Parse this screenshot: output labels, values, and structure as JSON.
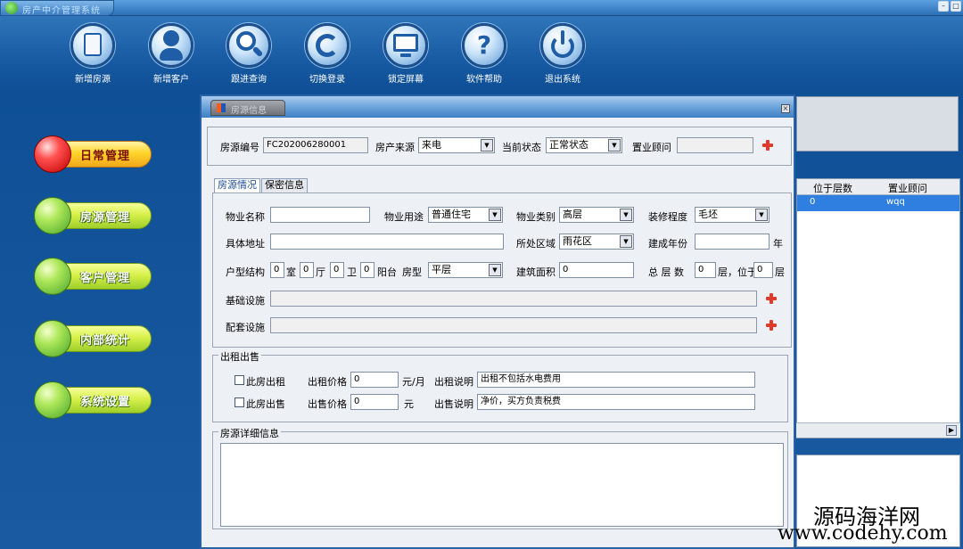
{
  "app": {
    "title": "房产中介管理系统"
  },
  "toolbar": {
    "items": [
      {
        "label": "新增房源",
        "icon": "document-icon"
      },
      {
        "label": "新增客户",
        "icon": "user-icon"
      },
      {
        "label": "跟进查询",
        "icon": "search-icon"
      },
      {
        "label": "切换登录",
        "icon": "refresh-icon"
      },
      {
        "label": "锁定屏幕",
        "icon": "monitor-lock-icon"
      },
      {
        "label": "软件帮助",
        "icon": "help-icon"
      },
      {
        "label": "退出系统",
        "icon": "power-icon"
      }
    ]
  },
  "nav": {
    "items": [
      {
        "label": "日常管理",
        "active": true
      },
      {
        "label": "房源管理",
        "active": false
      },
      {
        "label": "客户管理",
        "active": false
      },
      {
        "label": "内部统计",
        "active": false
      },
      {
        "label": "系统设置",
        "active": false
      }
    ]
  },
  "background_grid": {
    "columns": [
      "位于层数",
      "置业顾问"
    ],
    "rows": [
      {
        "floor": "0",
        "agent": "wqq"
      }
    ]
  },
  "dialog": {
    "title": "房源信息",
    "header": {
      "code_label": "房源编号",
      "code_value": "FC202006280001",
      "source_label": "房产来源",
      "source_value": "来电",
      "status_label": "当前状态",
      "status_value": "正常状态",
      "agent_label": "置业顾问",
      "agent_value": ""
    },
    "tabs": [
      "房源情况",
      "保密信息"
    ],
    "info": {
      "property_name_label": "物业名称",
      "property_name_value": "",
      "usage_label": "物业用途",
      "usage_value": "普通住宅",
      "category_label": "物业类别",
      "category_value": "高层",
      "decoration_label": "装修程度",
      "decoration_value": "毛坯",
      "address_label": "具体地址",
      "address_value": "",
      "district_label": "所处区域",
      "district_value": "雨花区",
      "year_label": "建成年份",
      "year_value": "",
      "year_unit": "年",
      "layout_label": "户型结构",
      "room_value": "0",
      "room_unit": "室",
      "hall_value": "0",
      "hall_unit": "厅",
      "bath_value": "0",
      "bath_unit": "卫",
      "balcony_value": "0",
      "balcony_unit": "阳台",
      "type_label": "房型",
      "type_value": "平层",
      "area_label": "建筑面积",
      "area_value": "0",
      "floors_label": "总 层 数",
      "floors_value": "0",
      "floors_unit": "层，位于",
      "floor_at_value": "0",
      "floor_at_unit": "层",
      "facility_label": "基础设施",
      "facility_value": "",
      "equipment_label": "配套设施",
      "equipment_value": ""
    },
    "rent_sale": {
      "legend": "出租出售",
      "rent_check_label": "此房出租",
      "rent_price_label": "出租价格",
      "rent_price_value": "0",
      "rent_unit": "元/月",
      "rent_note_label": "出租说明",
      "rent_note_value": "出租不包括水电费用",
      "sale_check_label": "此房出售",
      "sale_price_label": "出售价格",
      "sale_price_value": "0",
      "sale_unit": "元",
      "sale_note_label": "出售说明",
      "sale_note_value": "净价，买方负责税费"
    },
    "detail": {
      "legend": "房源详细信息",
      "value": ""
    }
  },
  "watermark": {
    "line1": "源码海洋网",
    "line2": "www.codehy.com"
  }
}
